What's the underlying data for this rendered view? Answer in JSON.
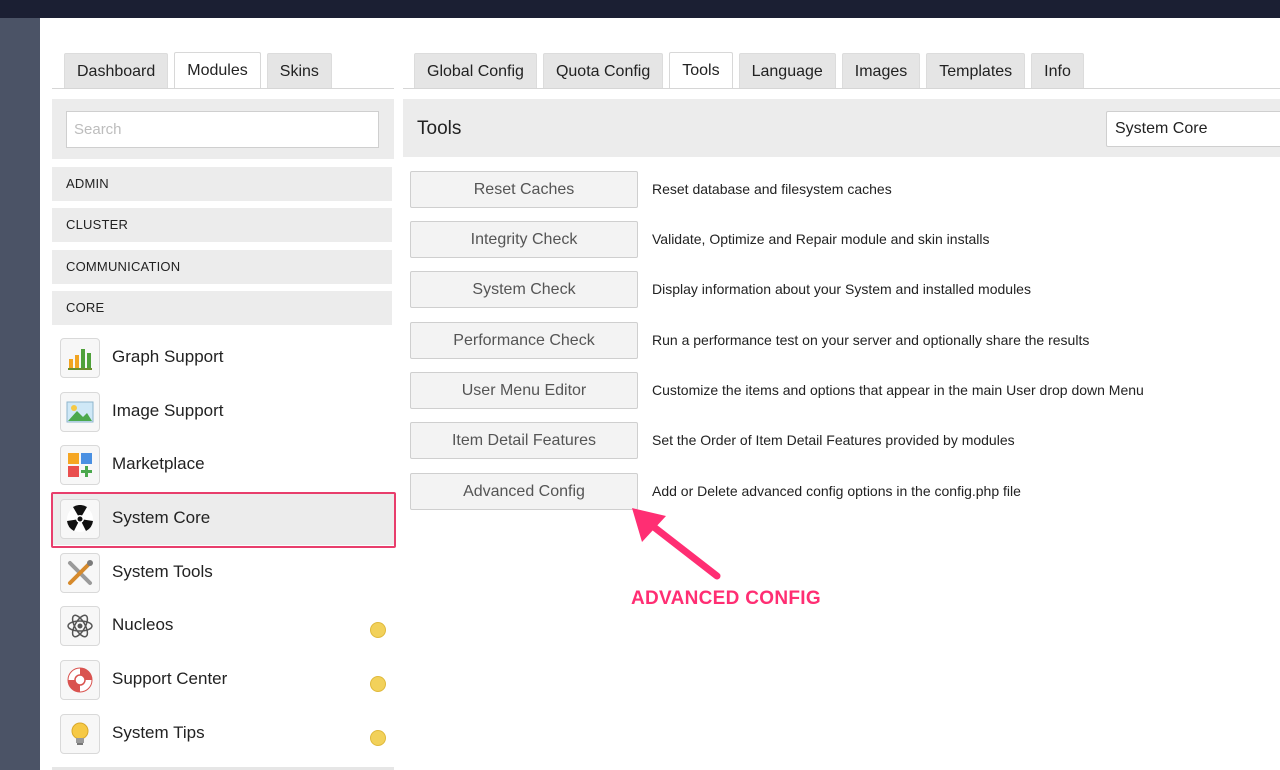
{
  "left_tabs": [
    "Dashboard",
    "Modules",
    "Skins"
  ],
  "left_active_tab": "Modules",
  "right_tabs": [
    "Global Config",
    "Quota Config",
    "Tools",
    "Language",
    "Images",
    "Templates",
    "Info"
  ],
  "right_active_tab": "Tools",
  "search": {
    "placeholder": "Search",
    "value": ""
  },
  "categories": [
    "ADMIN",
    "CLUSTER",
    "COMMUNICATION",
    "CORE"
  ],
  "modules": [
    {
      "label": "Graph Support",
      "icon": "bar-chart-icon",
      "badge": false
    },
    {
      "label": "Image Support",
      "icon": "image-icon",
      "badge": false
    },
    {
      "label": "Marketplace",
      "icon": "marketplace-icon",
      "badge": false
    },
    {
      "label": "System Core",
      "icon": "radiation-icon",
      "badge": false,
      "selected": true
    },
    {
      "label": "System Tools",
      "icon": "tools-icon",
      "badge": false
    },
    {
      "label": "Nucleos",
      "icon": "atom-icon",
      "badge": true
    },
    {
      "label": "Support Center",
      "icon": "lifebuoy-icon",
      "badge": true
    },
    {
      "label": "System Tips",
      "icon": "lightbulb-icon",
      "badge": true
    }
  ],
  "tools_panel": {
    "title": "Tools",
    "module_select": "System Core",
    "rows": [
      {
        "button": "Reset Caches",
        "description": "Reset database and filesystem caches"
      },
      {
        "button": "Integrity Check",
        "description": "Validate, Optimize and Repair module and skin installs"
      },
      {
        "button": "System Check",
        "description": "Display information about your System and installed modules"
      },
      {
        "button": "Performance Check",
        "description": "Run a performance test on your server and optionally share the results"
      },
      {
        "button": "User Menu Editor",
        "description": "Customize the items and options that appear in the main User drop down Menu"
      },
      {
        "button": "Item Detail Features",
        "description": "Set the Order of Item Detail Features provided by modules"
      },
      {
        "button": "Advanced Config",
        "description": "Add or Delete advanced config options in the config.php file"
      }
    ]
  },
  "annotation": {
    "text": "ADVANCED CONFIG",
    "color": "#ff2e73"
  },
  "colors": {
    "highlight_border": "#e83e6c",
    "badge": "#f2d15a",
    "panel_bg": "#ececec"
  }
}
